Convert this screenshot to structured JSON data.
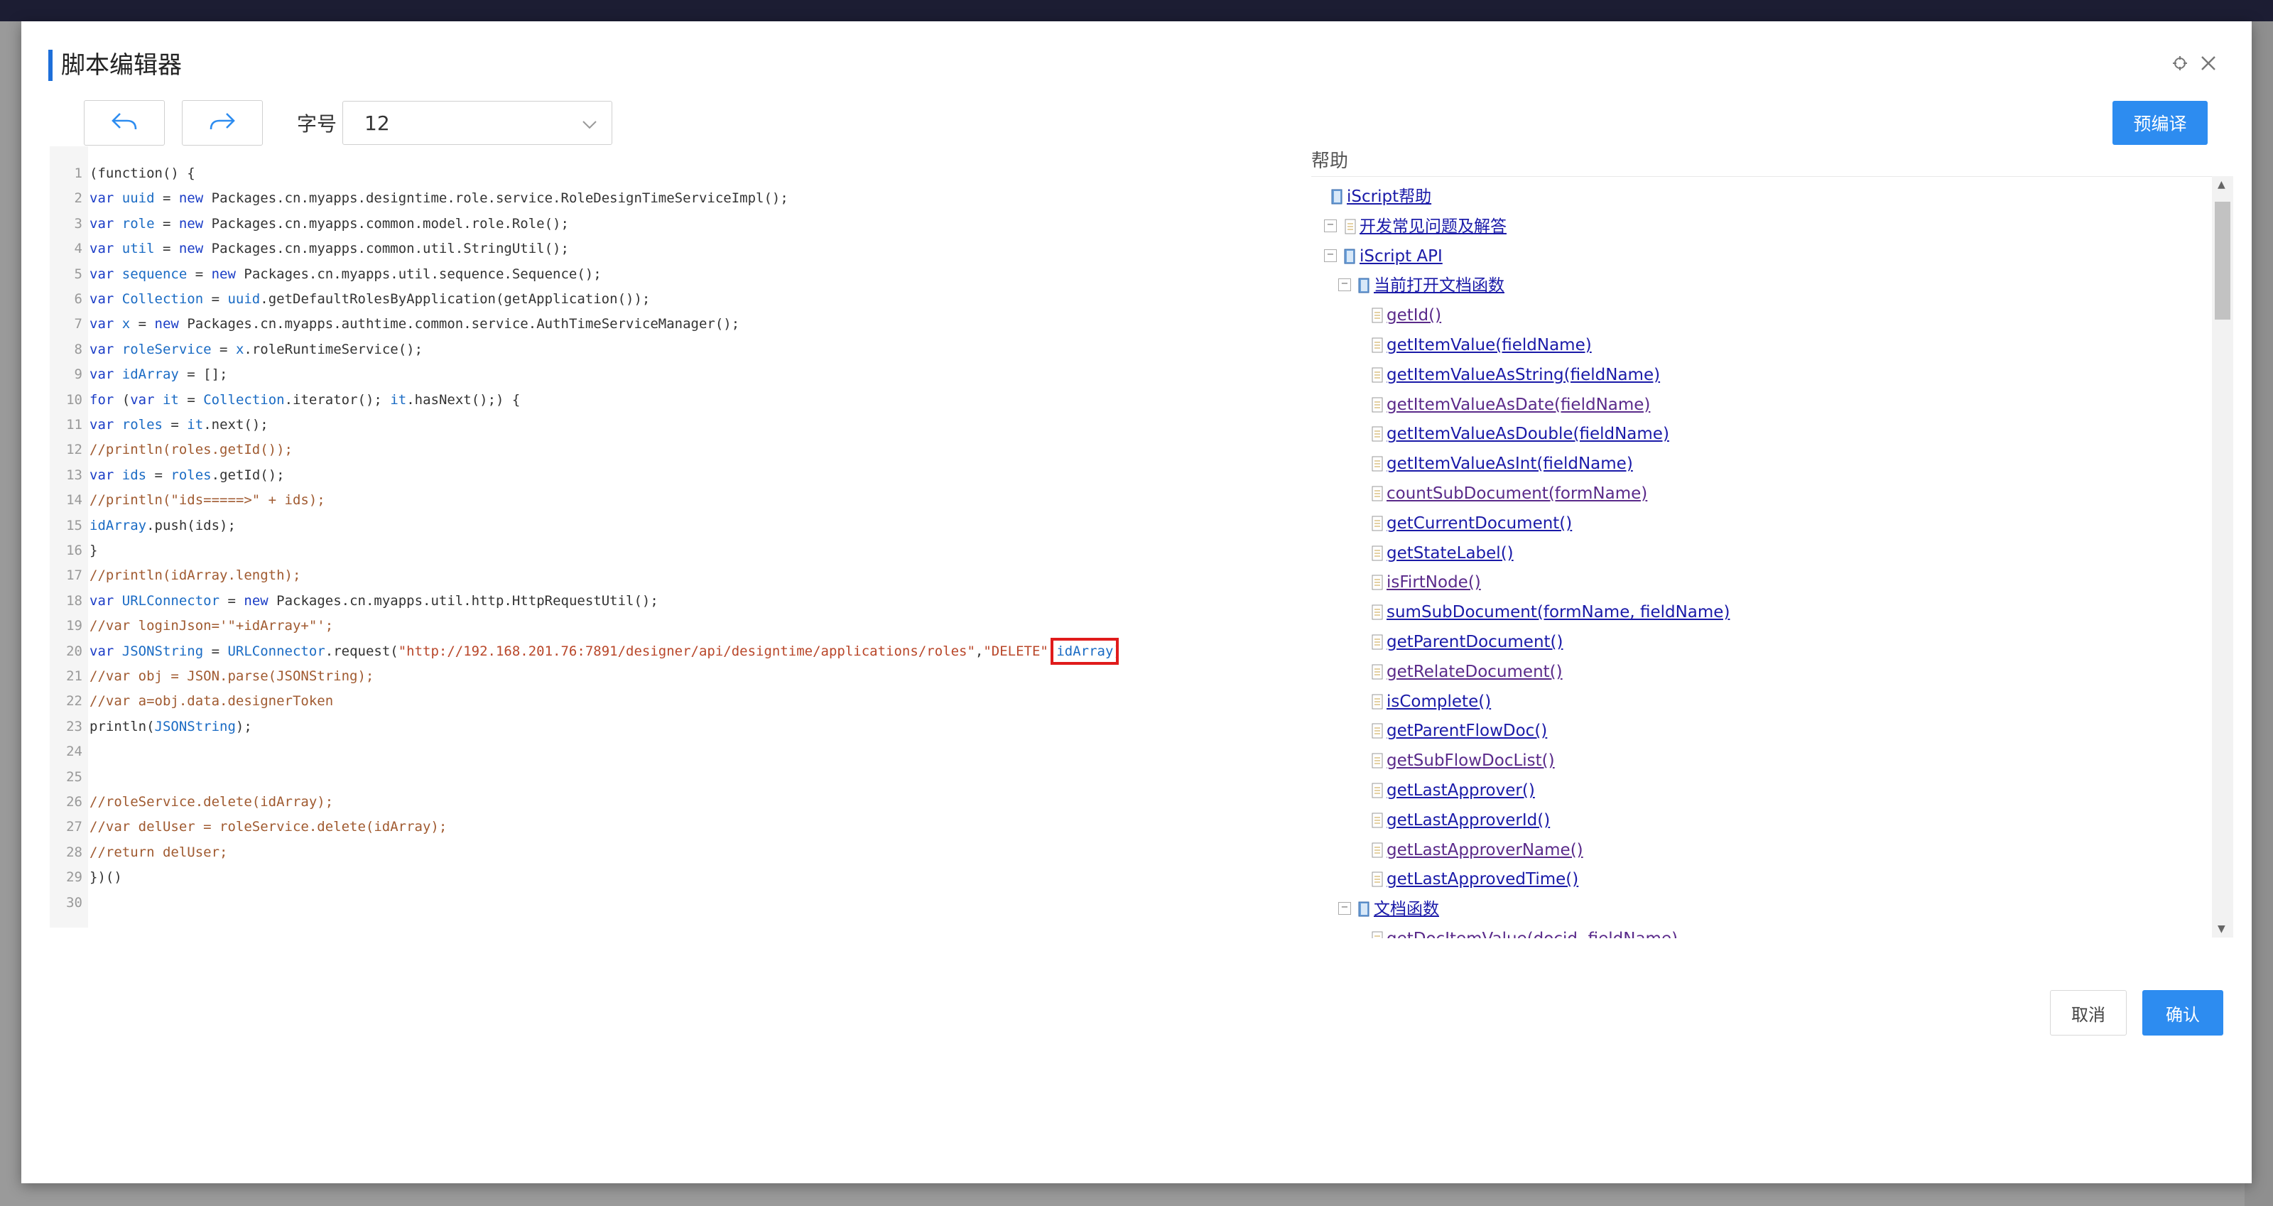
{
  "dialog": {
    "title": "脚本编辑器",
    "toolbar": {
      "font_size_label": "字号",
      "font_size_value": "12",
      "precompile_label": "预编译"
    },
    "footer": {
      "cancel_label": "取消",
      "confirm_label": "确认"
    }
  },
  "editor": {
    "lines": [
      {
        "n": "1",
        "segs": [
          {
            "t": "(function() {"
          }
        ]
      },
      {
        "n": "2",
        "segs": [
          {
            "t": "var ",
            "c": "kw"
          },
          {
            "t": "uuid",
            "c": "var"
          },
          {
            "t": " = "
          },
          {
            "t": "new ",
            "c": "kw"
          },
          {
            "t": "Packages.cn.myapps.designtime.role.service.RoleDesignTimeServiceImpl();"
          }
        ]
      },
      {
        "n": "3",
        "segs": [
          {
            "t": "var ",
            "c": "kw"
          },
          {
            "t": "role",
            "c": "var"
          },
          {
            "t": " = "
          },
          {
            "t": "new ",
            "c": "kw"
          },
          {
            "t": "Packages.cn.myapps.common.model.role.Role();"
          }
        ]
      },
      {
        "n": "4",
        "segs": [
          {
            "t": "var ",
            "c": "kw"
          },
          {
            "t": "util",
            "c": "var"
          },
          {
            "t": " = "
          },
          {
            "t": "new ",
            "c": "kw"
          },
          {
            "t": "Packages.cn.myapps.common.util.StringUtil();"
          }
        ]
      },
      {
        "n": "5",
        "segs": [
          {
            "t": "var ",
            "c": "kw"
          },
          {
            "t": "sequence",
            "c": "var"
          },
          {
            "t": " = "
          },
          {
            "t": "new ",
            "c": "kw"
          },
          {
            "t": "Packages.cn.myapps.util.sequence.Sequence();"
          }
        ]
      },
      {
        "n": "6",
        "segs": [
          {
            "t": "var ",
            "c": "kw"
          },
          {
            "t": "Collection",
            "c": "var"
          },
          {
            "t": " = "
          },
          {
            "t": "uuid",
            "c": "var"
          },
          {
            "t": ".getDefaultRolesByApplication(getApplication());"
          }
        ]
      },
      {
        "n": "7",
        "segs": [
          {
            "t": "var ",
            "c": "kw"
          },
          {
            "t": "x",
            "c": "var"
          },
          {
            "t": " = "
          },
          {
            "t": "new ",
            "c": "kw"
          },
          {
            "t": "Packages.cn.myapps.authtime.common.service.AuthTimeServiceManager();"
          }
        ]
      },
      {
        "n": "8",
        "segs": [
          {
            "t": "var ",
            "c": "kw"
          },
          {
            "t": "roleService",
            "c": "var"
          },
          {
            "t": " = "
          },
          {
            "t": "x",
            "c": "var"
          },
          {
            "t": ".roleRuntimeService();"
          }
        ]
      },
      {
        "n": "9",
        "segs": [
          {
            "t": "var ",
            "c": "kw"
          },
          {
            "t": "idArray",
            "c": "var"
          },
          {
            "t": " = [];"
          }
        ]
      },
      {
        "n": "10",
        "segs": [
          {
            "t": "for ",
            "c": "kw"
          },
          {
            "t": "("
          },
          {
            "t": "var ",
            "c": "kw"
          },
          {
            "t": "it",
            "c": "var"
          },
          {
            "t": " = "
          },
          {
            "t": "Collection",
            "c": "var"
          },
          {
            "t": ".iterator(); "
          },
          {
            "t": "it",
            "c": "var"
          },
          {
            "t": ".hasNext();) {"
          }
        ]
      },
      {
        "n": "11",
        "segs": [
          {
            "t": "var ",
            "c": "kw"
          },
          {
            "t": "roles",
            "c": "var"
          },
          {
            "t": " = "
          },
          {
            "t": "it",
            "c": "var"
          },
          {
            "t": ".next();"
          }
        ]
      },
      {
        "n": "12",
        "segs": [
          {
            "t": "//println(roles.getId());",
            "c": "cm"
          }
        ]
      },
      {
        "n": "13",
        "segs": [
          {
            "t": "var ",
            "c": "kw"
          },
          {
            "t": "ids",
            "c": "var"
          },
          {
            "t": " = "
          },
          {
            "t": "roles",
            "c": "var"
          },
          {
            "t": ".getId();"
          }
        ]
      },
      {
        "n": "14",
        "segs": [
          {
            "t": "//println(\"ids=====>\" + ids);",
            "c": "cm"
          }
        ]
      },
      {
        "n": "15",
        "segs": [
          {
            "t": "idArray",
            "c": "var"
          },
          {
            "t": ".push(ids);"
          }
        ]
      },
      {
        "n": "16",
        "segs": [
          {
            "t": "}"
          }
        ]
      },
      {
        "n": "17",
        "segs": [
          {
            "t": "//println(idArray.length);",
            "c": "cm"
          }
        ]
      },
      {
        "n": "18",
        "segs": [
          {
            "t": "var ",
            "c": "kw"
          },
          {
            "t": "URLConnector",
            "c": "var"
          },
          {
            "t": " = "
          },
          {
            "t": "new ",
            "c": "kw"
          },
          {
            "t": "Packages.cn.myapps.util.http.HttpRequestUtil();"
          }
        ]
      },
      {
        "n": "19",
        "segs": [
          {
            "t": "//var loginJson='\"+idArray+\"';",
            "c": "cm"
          }
        ]
      },
      {
        "n": "20",
        "segs": [
          {
            "t": "var ",
            "c": "kw"
          },
          {
            "t": "JSONString",
            "c": "var"
          },
          {
            "t": " = "
          },
          {
            "t": "URLConnector",
            "c": "var"
          },
          {
            "t": ".request("
          },
          {
            "t": "\"http://192.168.201.76:7891/designer/api/designtime/applications/roles\"",
            "c": "str"
          },
          {
            "t": ","
          },
          {
            "t": "\"DELETE\"",
            "c": "str"
          },
          {
            "t": ","
          },
          {
            "t": "idArray",
            "c": "var",
            "hl": true
          },
          {
            "t": ")"
          }
        ]
      },
      {
        "n": "21",
        "segs": [
          {
            "t": "//var obj = JSON.parse(JSONString);",
            "c": "cm"
          }
        ]
      },
      {
        "n": "22",
        "segs": [
          {
            "t": "//var a=obj.data.designerToken",
            "c": "cm"
          }
        ]
      },
      {
        "n": "23",
        "segs": [
          {
            "t": "println("
          },
          {
            "t": "JSONString",
            "c": "var"
          },
          {
            "t": ");"
          }
        ]
      },
      {
        "n": "24",
        "segs": []
      },
      {
        "n": "25",
        "segs": []
      },
      {
        "n": "26",
        "segs": [
          {
            "t": "//roleService.delete(idArray);",
            "c": "cm"
          }
        ]
      },
      {
        "n": "27",
        "segs": [
          {
            "t": "//var delUser = roleService.delete(idArray);",
            "c": "cm"
          }
        ]
      },
      {
        "n": "28",
        "segs": [
          {
            "t": "//return delUser;",
            "c": "cm"
          }
        ]
      },
      {
        "n": "29",
        "segs": [
          {
            "t": "})()"
          }
        ]
      },
      {
        "n": "30",
        "segs": []
      }
    ]
  },
  "help": {
    "title": "帮助",
    "tree": [
      {
        "label": "iScript帮助",
        "level": 0,
        "icon": "book-icon",
        "exp": false
      },
      {
        "label": "开发常见问题及解答",
        "level": 1,
        "icon": "doc-icon",
        "exp": true
      },
      {
        "label": "iScript API",
        "level": 1,
        "icon": "book-icon",
        "exp": false
      },
      {
        "label": "当前打开文档函数",
        "level": 2,
        "icon": "book-icon",
        "exp": true
      },
      {
        "label": "getId()",
        "level": 3,
        "icon": "doc-icon"
      },
      {
        "label": "getItemValue(fieldName)",
        "level": 3,
        "icon": "doc-icon"
      },
      {
        "label": "getItemValueAsString(fieldName)",
        "level": 3,
        "icon": "doc-icon"
      },
      {
        "label": "getItemValueAsDate(fieldName)",
        "level": 3,
        "icon": "doc-icon"
      },
      {
        "label": "getItemValueAsDouble(fieldName)",
        "level": 3,
        "icon": "doc-icon"
      },
      {
        "label": "getItemValueAsInt(fieldName)",
        "level": 3,
        "icon": "doc-icon"
      },
      {
        "label": "countSubDocument(formName)",
        "level": 3,
        "icon": "doc-icon"
      },
      {
        "label": "getCurrentDocument()",
        "level": 3,
        "icon": "doc-icon"
      },
      {
        "label": "getStateLabel()",
        "level": 3,
        "icon": "doc-icon"
      },
      {
        "label": "isFirtNode()",
        "level": 3,
        "icon": "doc-icon"
      },
      {
        "label": "sumSubDocument(formName, fieldName)",
        "level": 3,
        "icon": "doc-icon"
      },
      {
        "label": "getParentDocument()",
        "level": 3,
        "icon": "doc-icon"
      },
      {
        "label": "getRelateDocument()",
        "level": 3,
        "icon": "doc-icon"
      },
      {
        "label": "isComplete()",
        "level": 3,
        "icon": "doc-icon"
      },
      {
        "label": "getParentFlowDoc()",
        "level": 3,
        "icon": "doc-icon"
      },
      {
        "label": "getSubFlowDocList()",
        "level": 3,
        "icon": "doc-icon"
      },
      {
        "label": "getLastApprover()",
        "level": 3,
        "icon": "doc-icon"
      },
      {
        "label": "getLastApproverId()",
        "level": 3,
        "icon": "doc-icon"
      },
      {
        "label": "getLastApproverName()",
        "level": 3,
        "icon": "doc-icon"
      },
      {
        "label": "getLastApprovedTime()",
        "level": 3,
        "icon": "doc-icon"
      },
      {
        "label": "文档函数",
        "level": 2,
        "icon": "book-icon",
        "exp": true
      },
      {
        "label": "getDocItemValue(docid, fieldName)",
        "level": 3,
        "icon": "doc-icon"
      }
    ]
  },
  "colors": {
    "accent": "#2d8cf0",
    "title_bar": "#1e6fd9",
    "highlight_box": "#e01b1b"
  }
}
